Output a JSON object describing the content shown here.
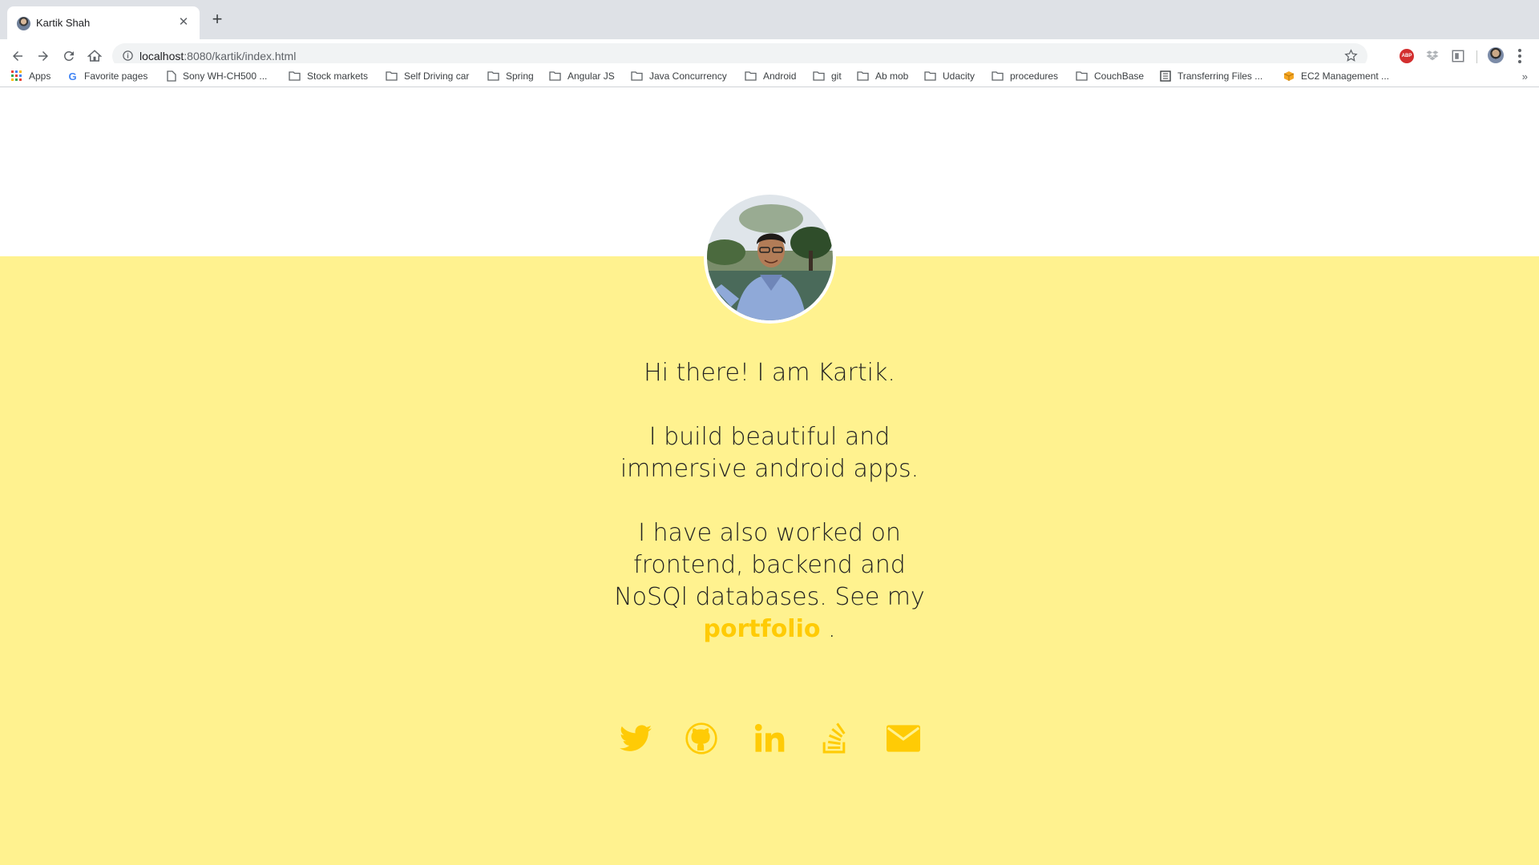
{
  "browser": {
    "tab_title": "Kartik Shah",
    "url_host": "localhost",
    "url_path": ":8080/kartik/index.html",
    "abp_label": "ABP"
  },
  "bookmarks": [
    {
      "label": "Apps",
      "icon": "apps-grid-icon"
    },
    {
      "label": "Favorite pages",
      "icon": "google-icon"
    },
    {
      "label": "Sony WH-CH500 ...",
      "icon": "page-icon"
    },
    {
      "label": "Stock markets",
      "icon": "folder-icon"
    },
    {
      "label": "Self Driving car",
      "icon": "folder-icon"
    },
    {
      "label": "Spring",
      "icon": "folder-icon"
    },
    {
      "label": "Angular JS",
      "icon": "folder-icon"
    },
    {
      "label": "Java Concurrency",
      "icon": "folder-icon"
    },
    {
      "label": "Android",
      "icon": "folder-icon"
    },
    {
      "label": "git",
      "icon": "folder-icon"
    },
    {
      "label": "Ab mob",
      "icon": "folder-icon"
    },
    {
      "label": "Udacity",
      "icon": "folder-icon"
    },
    {
      "label": "procedures",
      "icon": "folder-icon"
    },
    {
      "label": "CouchBase",
      "icon": "folder-icon"
    },
    {
      "label": "Transferring Files ...",
      "icon": "doc-icon"
    },
    {
      "label": "EC2 Management ...",
      "icon": "aws-icon"
    }
  ],
  "bookmarks_more": "»",
  "hero": {
    "greeting": "Hi there! I am Kartik.",
    "line2": "I build beautiful and immersive android apps.",
    "line3_prefix": "I have also worked on frontend, backend and NoSQl databases. See my",
    "portfolio_link": "portfolio",
    "line3_suffix": "."
  },
  "social": [
    "twitter-icon",
    "github-icon",
    "linkedin-icon",
    "stackoverflow-icon",
    "email-icon"
  ],
  "colors": {
    "accent": "#ffcb05",
    "background_yellow": "#fff28f",
    "text": "#222222"
  }
}
